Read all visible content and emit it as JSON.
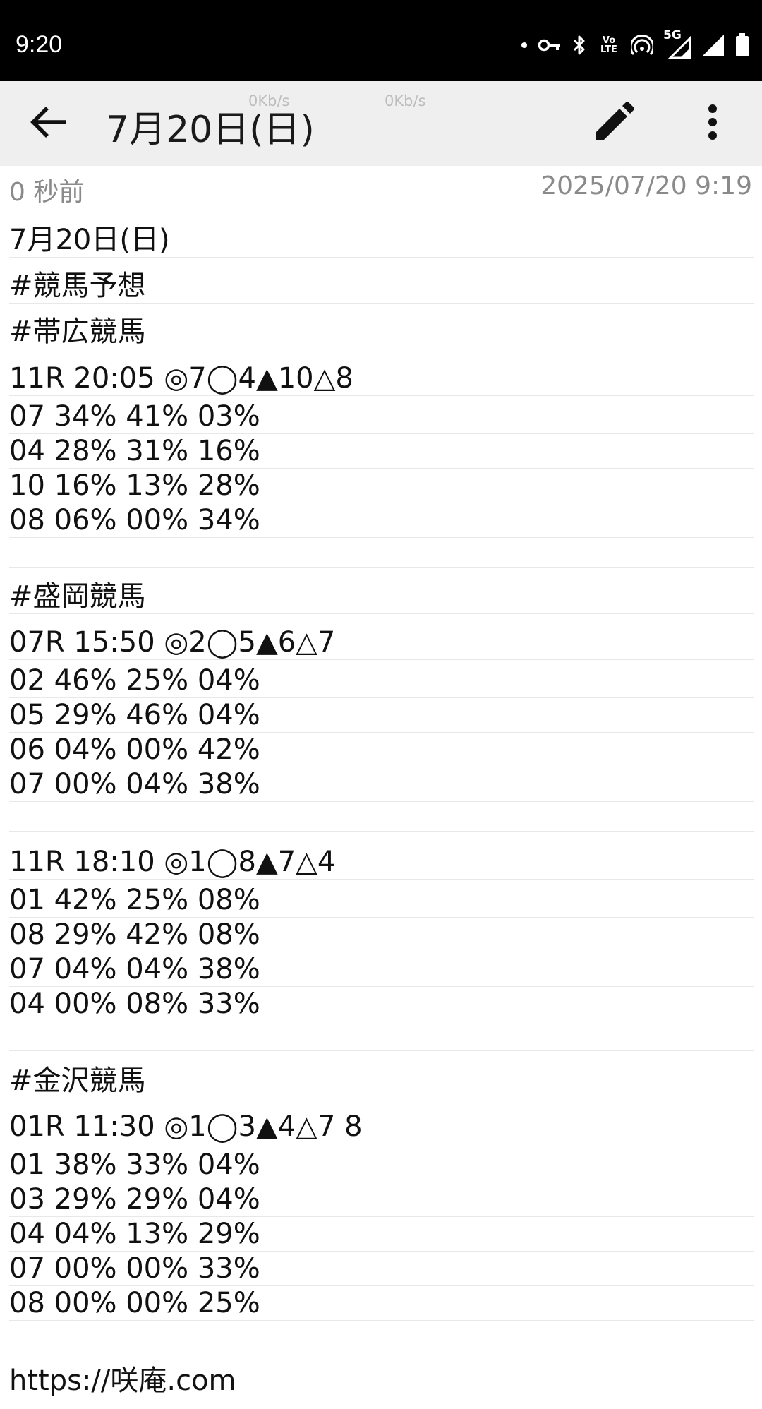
{
  "status_bar": {
    "time": "9:20",
    "icons": [
      "dot-icon",
      "vpn-key-icon",
      "bluetooth-icon",
      "volte-icon",
      "hotspot-icon",
      "signal-5g-icon",
      "signal-icon",
      "battery-icon"
    ],
    "volte_text": "Vo LTE",
    "network_type": "5G"
  },
  "app_bar": {
    "title": "7月20日(日)",
    "net_speed_1": "0Kb/s",
    "net_speed_2": "0Kb/s"
  },
  "meta": {
    "relative_time": "0 秒前",
    "timestamp": "2025/07/20 9:19"
  },
  "note": {
    "lines": [
      "7月20日(日)",
      "#競馬予想",
      "#帯広競馬",
      "11R 20:05 ◎7◯4▲10△8",
      "07 34% 41% 03%",
      "04 28% 31% 16%",
      "10 16% 13% 28%",
      "08 06% 00% 34%",
      "",
      "#盛岡競馬",
      "07R 15:50 ◎2◯5▲6△7",
      "02 46% 25% 04%",
      "05 29% 46% 04%",
      "06 04% 00% 42%",
      "07 00% 04% 38%",
      "",
      "11R 18:10 ◎1◯8▲7△4",
      "01 42% 25% 08%",
      "08 29% 42% 08%",
      "07 04% 04% 38%",
      "04 00% 08% 33%",
      "",
      "#金沢競馬",
      "01R 11:30 ◎1◯3▲4△7 8",
      "01 38% 33% 04%",
      "03 29% 29% 04%",
      "04 04% 13% 29%",
      "07 00% 00% 33%",
      "08 00% 00% 25%",
      "",
      "https://咲庵.com"
    ]
  },
  "colors": {
    "status_bar_bg": "#000000",
    "app_bar_bg": "#efefef",
    "meta_text": "#8a8a8a",
    "rule_line": "#e8e8e8"
  }
}
